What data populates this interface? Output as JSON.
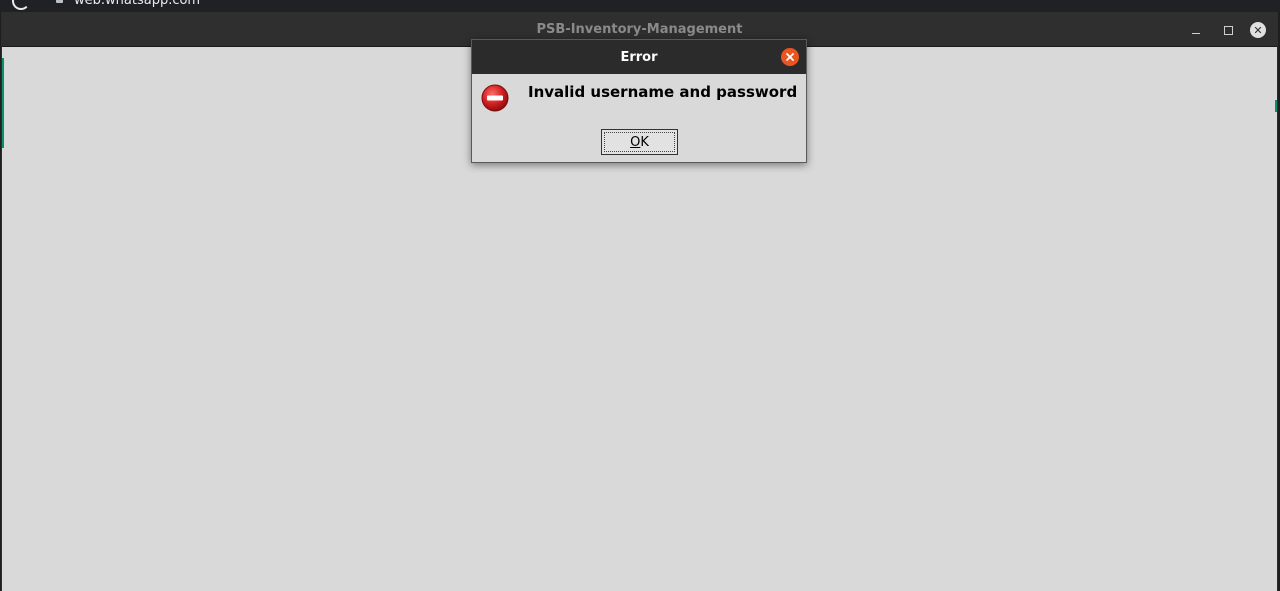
{
  "browser": {
    "url": "web.whatsapp.com"
  },
  "app_window": {
    "title": "PSB-Inventory-Management"
  },
  "dialog": {
    "title": "Error",
    "message": "Invalid username and password",
    "ok_mnemonic": "O",
    "ok_rest": "K",
    "icon": "error-stop-icon"
  },
  "colors": {
    "dialog_close": "#e95420",
    "error_icon": "#d21f1f",
    "titlebar": "#2b2b2b",
    "window_bg": "#d9d9d9"
  }
}
